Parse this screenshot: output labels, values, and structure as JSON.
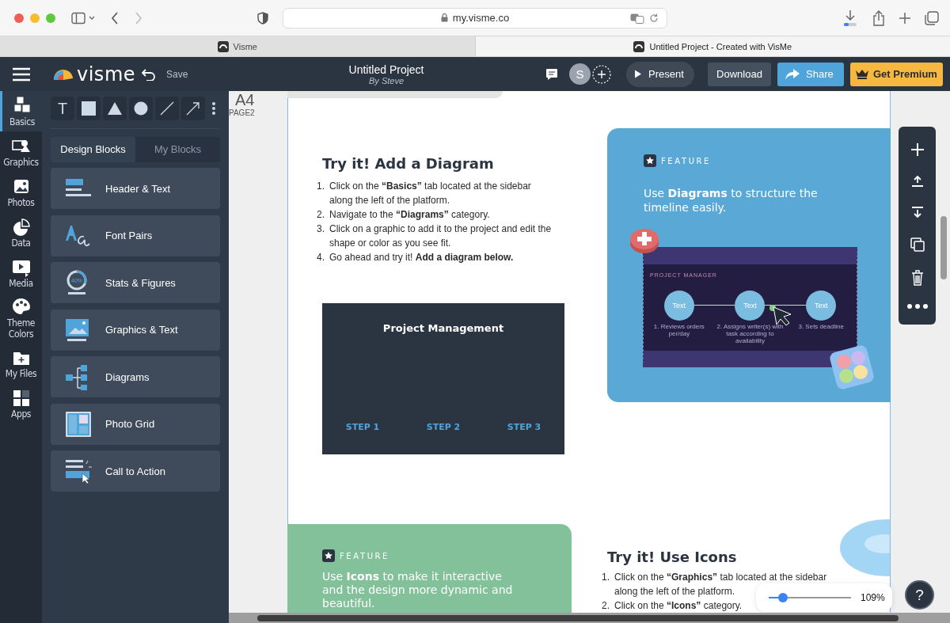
{
  "browser": {
    "url": "my.visme.co",
    "tabs": [
      {
        "title": "Visme",
        "selected": false
      },
      {
        "title": "Untitled Project - Created with VisMe",
        "selected": true
      }
    ]
  },
  "header": {
    "logo": "visme",
    "save": "Save",
    "project_title": "Untitled Project",
    "author": "By Steve",
    "avatar": "S",
    "present": "Present",
    "download": "Download",
    "share": "Share",
    "premium": "Get Premium"
  },
  "rail": [
    {
      "label": "Basics",
      "selected": true
    },
    {
      "label": "Graphics",
      "selected": false
    },
    {
      "label": "Photos",
      "selected": false
    },
    {
      "label": "Data",
      "selected": false
    },
    {
      "label": "Media",
      "selected": false
    },
    {
      "label": "Theme Colors",
      "selected": false
    },
    {
      "label": "My Files",
      "selected": false
    },
    {
      "label": "Apps",
      "selected": false
    }
  ],
  "tools": {
    "text_tool": "T"
  },
  "panel_tabs": [
    {
      "label": "Design Blocks",
      "selected": true
    },
    {
      "label": "My Blocks",
      "selected": false
    }
  ],
  "blocks": [
    "Header & Text",
    "Font Pairs",
    "Stats & Figures",
    "Graphics & Text",
    "Diagrams",
    "Photo Grid",
    "Call to Action"
  ],
  "block_icon_text": "40%",
  "page_marker": {
    "size": "A4",
    "page": "PAGE2"
  },
  "diagram_section": {
    "heading": "Try it! Add a Diagram",
    "steps": [
      {
        "number": "1.",
        "text": "Click on the **“Basics”** tab located at the sidebar along the left of the platform."
      },
      {
        "number": "2.",
        "text": "Navigate to the **“Diagrams”** category."
      },
      {
        "number": "3.",
        "text": "Click on a graphic to add it to the project and edit the shape or color as you see fit."
      },
      {
        "number": "4.",
        "text": "Go ahead and try it! **Add a diagram below.**"
      }
    ],
    "diagram": {
      "title": "Project Management",
      "steps": [
        "STEP 1",
        "STEP 2",
        "STEP 3"
      ]
    }
  },
  "feature_diagrams": {
    "label": "FEATURE",
    "text": "Use **Diagrams** to structure the timeline easily.",
    "preview": {
      "title": "PROJECT MANAGER",
      "nodes": [
        {
          "label": "Text",
          "caption": "1. Reviews orders per/day"
        },
        {
          "label": "Text",
          "caption": "2. Assigns writer(s) with task according to availability"
        },
        {
          "label": "Text",
          "caption": "3. Sets deadline"
        }
      ]
    }
  },
  "feature_icons": {
    "label": "FEATURE",
    "text": "Use **Icons** to make it interactive and the design more dynamic and beautiful."
  },
  "icons_section": {
    "heading": "Try it! Use Icons",
    "steps": [
      {
        "number": "1.",
        "text": "Click on the **“Graphics”** tab located at the sidebar along the left of the platform."
      },
      {
        "number": "2.",
        "text": "Click on the **“Icons”** category."
      }
    ]
  },
  "zoom": {
    "level": 0.17,
    "reading": "109%"
  },
  "help": "?"
}
